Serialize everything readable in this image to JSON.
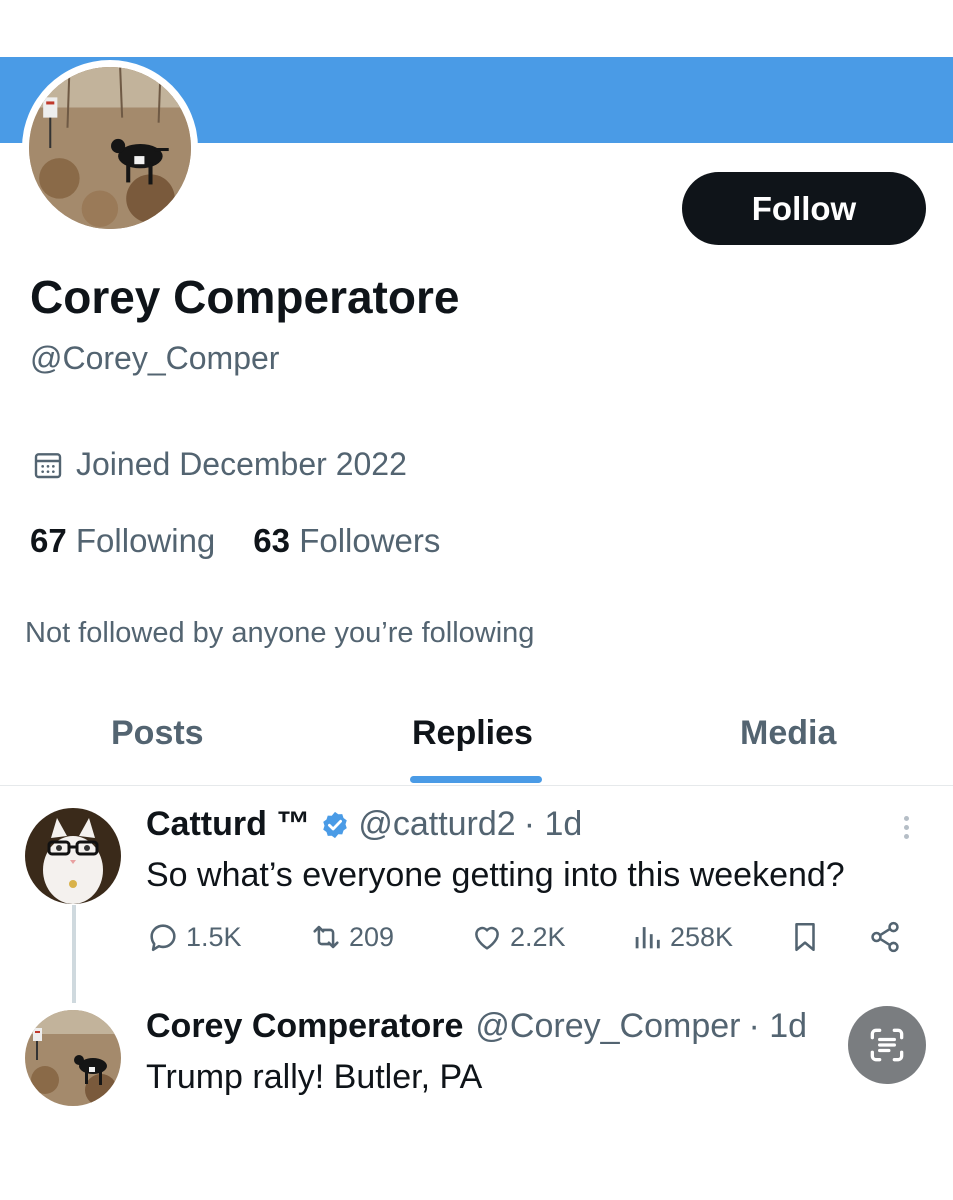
{
  "profile": {
    "name": "Corey Comperatore",
    "handle": "@Corey_Comper",
    "joined": "Joined December 2022",
    "following_count": "67",
    "following_label": "Following",
    "followers_count": "63",
    "followers_label": "Followers",
    "not_followed_note": "Not followed by anyone you’re following",
    "follow_button": "Follow",
    "banner_color": "#4a9be6"
  },
  "tabs": [
    {
      "label": "Posts",
      "active": false
    },
    {
      "label": "Replies",
      "active": true
    },
    {
      "label": "Media",
      "active": false
    }
  ],
  "tweets": [
    {
      "name": "Catturd ™",
      "verified": true,
      "handle": "@catturd2",
      "time": "· 1d",
      "text": "So what’s everyone getting into this weekend?",
      "actions": {
        "replies": "1.5K",
        "reposts": "209",
        "likes": "2.2K",
        "views": "258K"
      }
    },
    {
      "name": "Corey Comperatore",
      "handle": "@Corey_Comper",
      "time": "· 1d",
      "text": "Trump rally! Butler, PA"
    }
  ],
  "icons": {
    "calendar": "calendar-icon",
    "verified": "verified-badge-icon",
    "reply": "reply-icon",
    "repost": "repost-icon",
    "like": "heart-icon",
    "views": "views-chart-icon",
    "bookmark": "bookmark-icon",
    "share": "share-icon",
    "more": "more-vertical-icon",
    "scan": "text-scan-icon"
  },
  "colors": {
    "accent": "#4a9be6",
    "text_primary": "#0f1419",
    "text_secondary": "#536471"
  }
}
